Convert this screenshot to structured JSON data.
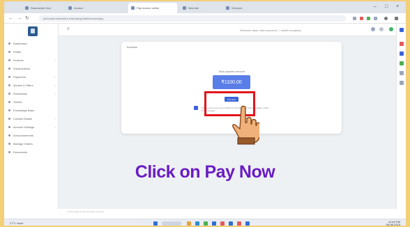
{
  "browser": {
    "tabs": [
      {
        "label": "Ravenshire Hub",
        "active": false
      },
      {
        "label": "Invoice",
        "active": false
      },
      {
        "label": "Pay invoice online",
        "active": true
      },
      {
        "label": "New tab",
        "active": false
      },
      {
        "label": "Services",
        "active": false
      }
    ],
    "url": "accounts.ravenshire.example/portal/invoices/pay"
  },
  "sidebar": {
    "items": [
      {
        "label": "Dashboard",
        "has_caret": false
      },
      {
        "label": "Profile",
        "has_caret": false
      },
      {
        "label": "Invoices",
        "has_caret": true
      },
      {
        "label": "Subscriptions",
        "has_caret": false
      },
      {
        "label": "Payments",
        "has_caret": true
      },
      {
        "label": "Quotes & Offers",
        "has_caret": true
      },
      {
        "label": "Downloads",
        "has_caret": true
      },
      {
        "label": "Tickets",
        "has_caret": false
      },
      {
        "label": "Knowledge Base",
        "has_caret": false
      },
      {
        "label": "Contact Details",
        "has_caret": true
      },
      {
        "label": "Account Settings",
        "has_caret": true
      },
      {
        "label": "Announcements",
        "has_caret": false
      },
      {
        "label": "Manage Orders",
        "has_caret": false
      },
      {
        "label": "Documents",
        "has_caret": false
      }
    ]
  },
  "header": {
    "account_text": "Welcome back, client account — switch company"
  },
  "payment": {
    "card_title": "Invoices",
    "amount_label": "Total payable amount",
    "amount": "₹1100.00",
    "pay_button": "Pay Now",
    "terms_text": "I agree to the terms and conditions and the refund and cancellation policy of the company"
  },
  "caption": "Click on Pay Now",
  "footer": "© Ravenshire Portal. All rights reserved.",
  "taskbar": {
    "left_label": "27°C Haze",
    "time": "12:40 PM",
    "date": "05-08-2023"
  },
  "colors": {
    "accent": "#5a7ee8",
    "highlight": "#e1161a",
    "caption": "#6a1cc4",
    "frame": "#f3cf78"
  }
}
